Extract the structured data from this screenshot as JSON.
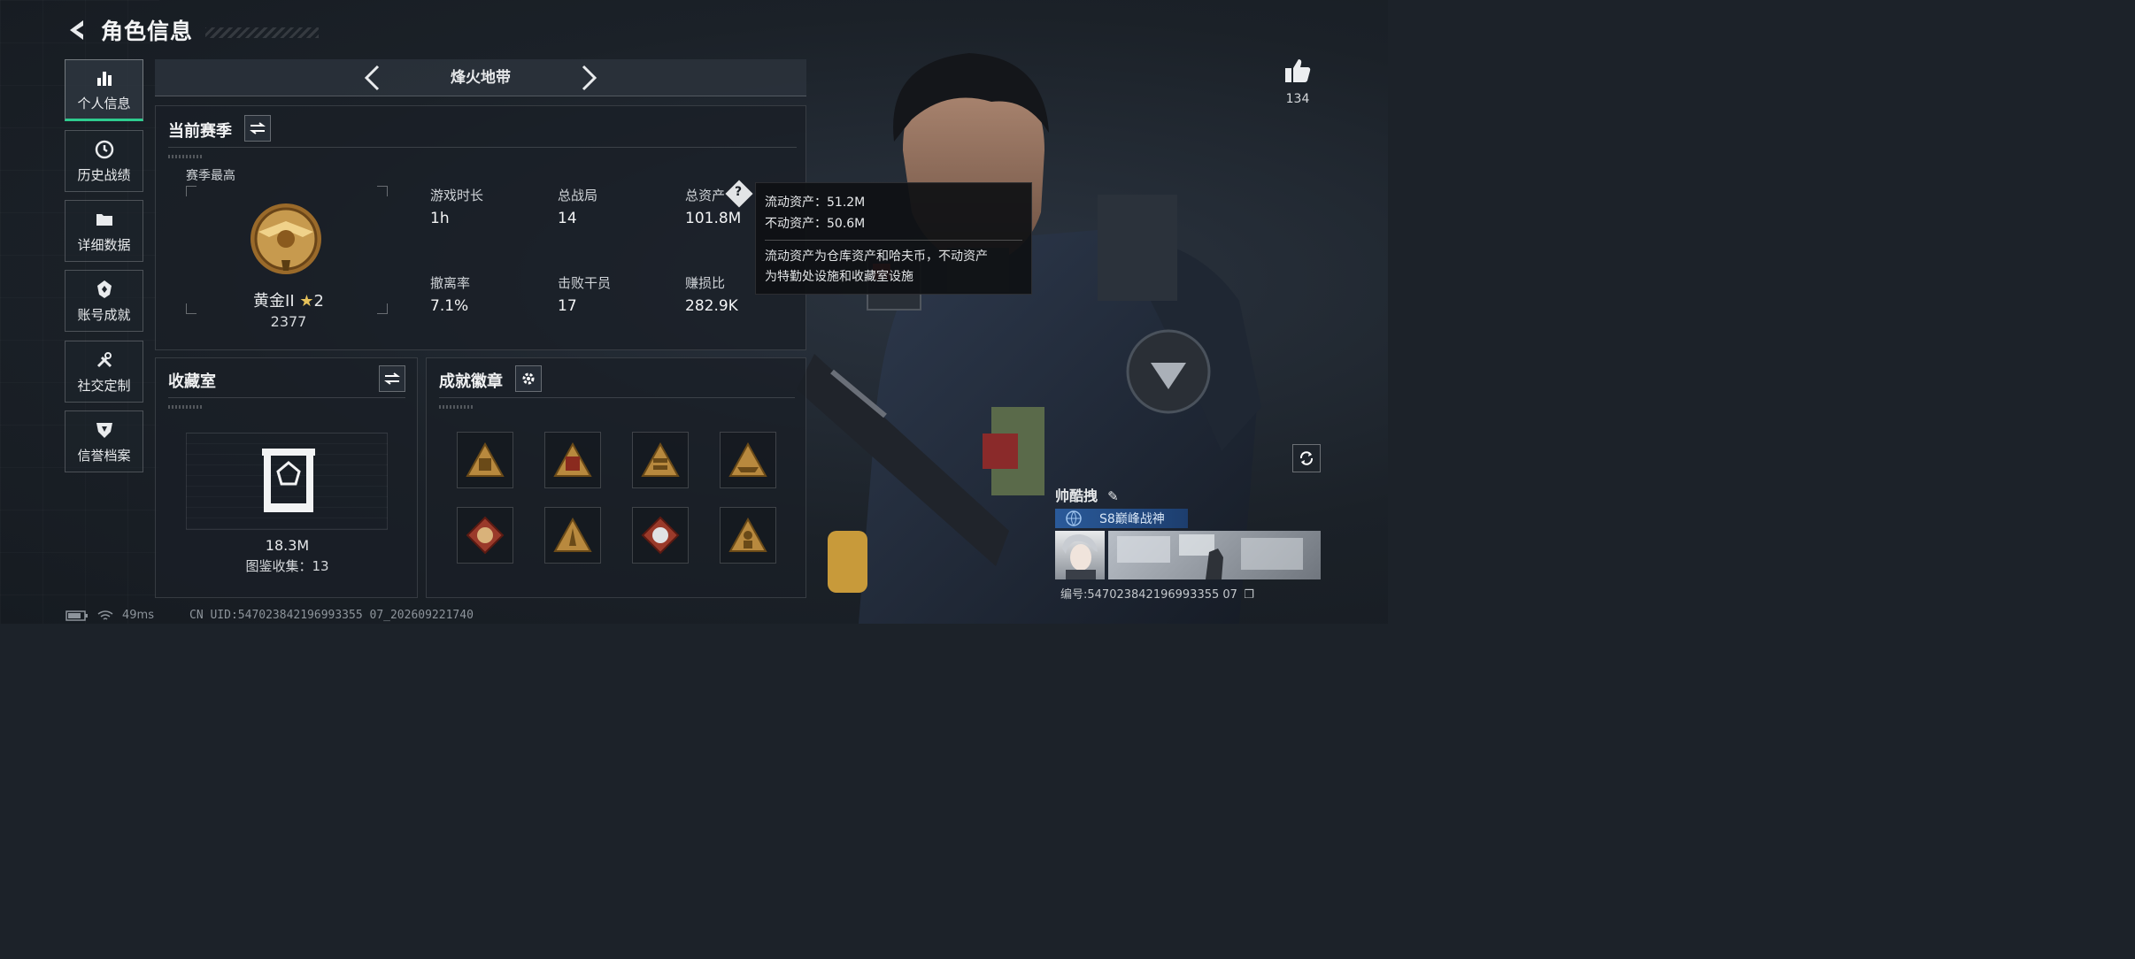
{
  "header": {
    "title": "角色信息"
  },
  "sidebar": {
    "items": [
      {
        "label": "个人信息",
        "icon": "bar-chart-icon",
        "active": true
      },
      {
        "label": "历史战绩",
        "icon": "history-clock-icon"
      },
      {
        "label": "详细数据",
        "icon": "folder-icon"
      },
      {
        "label": "账号成就",
        "icon": "achievement-icon"
      },
      {
        "label": "社交定制",
        "icon": "tools-icon"
      },
      {
        "label": "信誉档案",
        "icon": "shield-icon"
      }
    ]
  },
  "mode": {
    "label": "烽火地带"
  },
  "season": {
    "title": "当前赛季",
    "best_label": "赛季最高",
    "rank_name": "黄金II",
    "rank_stars": "2",
    "rank_score": "2377",
    "stats": [
      {
        "label": "游戏时长",
        "value": "1h"
      },
      {
        "label": "总战局",
        "value": "14"
      },
      {
        "label": "总资产",
        "value": "101.8M"
      },
      {
        "label": "撤离率",
        "value": "7.1%"
      },
      {
        "label": "击败干员",
        "value": "17"
      },
      {
        "label": "赚损比",
        "value": "282.9K"
      }
    ]
  },
  "tooltip": {
    "liquid": "流动资产：51.2M",
    "fixed": "不动资产：50.6M",
    "desc_line1": "流动资产为仓库资产和哈夫币，不动资产",
    "desc_line2": "为特勤处设施和收藏室设施"
  },
  "collection": {
    "title": "收藏室",
    "value": "18.3M",
    "count_text": "图鉴收集：13"
  },
  "badges": {
    "title": "成就徽章",
    "items": [
      {
        "icon": "badge-crate-icon",
        "color": "#b8893e"
      },
      {
        "icon": "badge-s8-icon",
        "color": "#b8893e"
      },
      {
        "icon": "badge-stack-icon",
        "color": "#b8893e"
      },
      {
        "icon": "badge-ship-icon",
        "color": "#b8893e"
      },
      {
        "icon": "badge-dragon-icon",
        "color": "#9a3a2a"
      },
      {
        "icon": "badge-rocket-icon",
        "color": "#b8893e"
      },
      {
        "icon": "badge-beast-icon",
        "color": "#9a3a2a"
      },
      {
        "icon": "badge-soldier-icon",
        "color": "#b8893e"
      }
    ]
  },
  "likes": {
    "count": "134"
  },
  "profile": {
    "name": "帅酷拽",
    "title_badge": "S8巅峰战神",
    "id_text": "编号:547023842196993355 07"
  },
  "status": {
    "ping": "49ms",
    "uid": "CN UID:547023842196993355 07_202609221740"
  }
}
